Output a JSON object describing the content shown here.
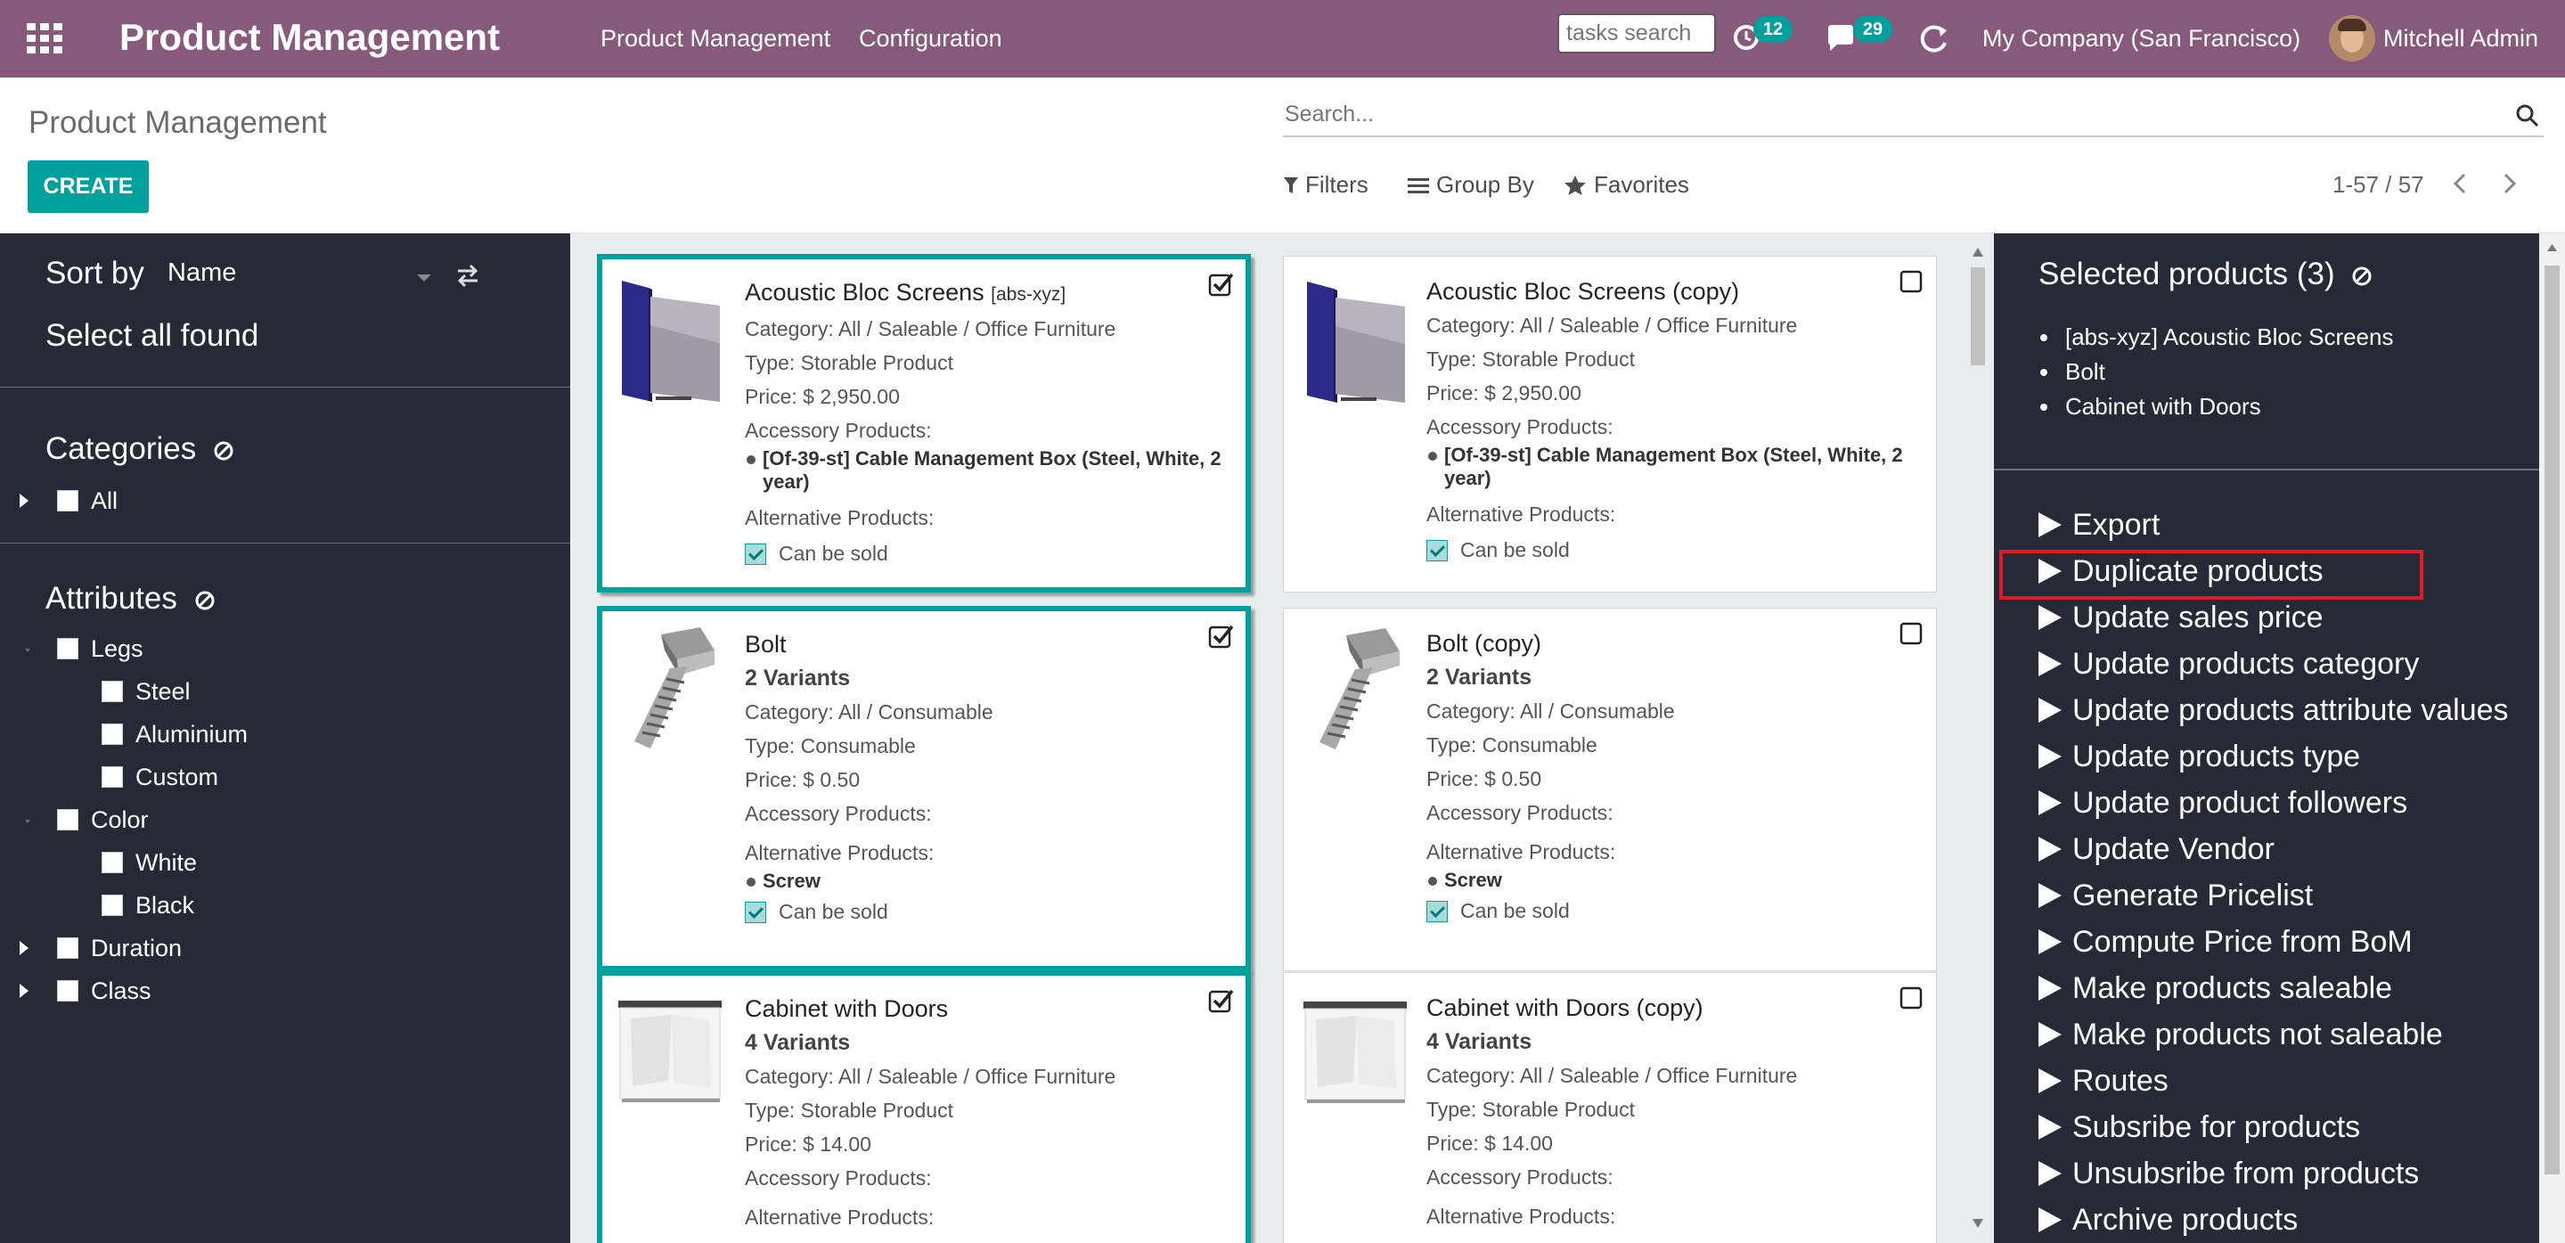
{
  "navbar": {
    "brand": "Product Management",
    "menu": [
      "Product Management",
      "Configuration"
    ],
    "task_search_placeholder": "tasks search",
    "activity_count": "12",
    "messages_count": "29",
    "company": "My Company (San Francisco)",
    "user": "Mitchell Admin",
    "bg_color": "#875a7b"
  },
  "control_panel": {
    "title": "Product Management",
    "create_label": "CREATE",
    "search_placeholder": "Search...",
    "filters_label": "Filters",
    "group_by_label": "Group By",
    "favorites_label": "Favorites",
    "pager": "1-57 / 57"
  },
  "left_panel": {
    "sort_label": "Sort by",
    "sort_value": "Name",
    "select_all_label": "Select all found",
    "categories_title": "Categories",
    "categories": [
      {
        "label": "All",
        "expandable": true
      }
    ],
    "attributes_title": "Attributes",
    "attributes": [
      {
        "label": "Legs",
        "children": [
          "Steel",
          "Aluminium",
          "Custom"
        ]
      },
      {
        "label": "Color",
        "children": [
          "White",
          "Black"
        ]
      },
      {
        "label": "Duration",
        "children": []
      },
      {
        "label": "Class",
        "children": []
      }
    ]
  },
  "cards": [
    {
      "title": "Acoustic Bloc Screens",
      "code": "[abs-xyz]",
      "variants": "",
      "category": "Category: All / Saleable / Office Furniture",
      "type": "Type: Storable Product",
      "price": "Price: $ 2,950.00",
      "accessory_label": "Accessory Products:",
      "accessories": [
        "[Of-39-st] Cable Management Box (Steel, White, 2 year)"
      ],
      "alternative_label": "Alternative Products:",
      "alternatives": [],
      "sold_label": "Can be sold",
      "selected": true,
      "image": "screen"
    },
    {
      "title": "Acoustic Bloc Screens (copy)",
      "code": "",
      "variants": "",
      "category": "Category: All / Saleable / Office Furniture",
      "type": "Type: Storable Product",
      "price": "Price: $ 2,950.00",
      "accessory_label": "Accessory Products:",
      "accessories": [
        "[Of-39-st] Cable Management Box (Steel, White, 2 year)"
      ],
      "alternative_label": "Alternative Products:",
      "alternatives": [],
      "sold_label": "Can be sold",
      "selected": false,
      "image": "screen"
    },
    {
      "title": "Bolt",
      "code": "",
      "variants": "2 Variants",
      "category": "Category: All / Consumable",
      "type": "Type: Consumable",
      "price": "Price: $ 0.50",
      "accessory_label": "Accessory Products:",
      "accessories": [],
      "alternative_label": "Alternative Products:",
      "alternatives": [
        "Screw"
      ],
      "sold_label": "Can be sold",
      "selected": true,
      "image": "bolt"
    },
    {
      "title": "Bolt (copy)",
      "code": "",
      "variants": "2 Variants",
      "category": "Category: All / Consumable",
      "type": "Type: Consumable",
      "price": "Price: $ 0.50",
      "accessory_label": "Accessory Products:",
      "accessories": [],
      "alternative_label": "Alternative Products:",
      "alternatives": [
        "Screw"
      ],
      "sold_label": "Can be sold",
      "selected": false,
      "image": "bolt"
    },
    {
      "title": "Cabinet with Doors",
      "code": "",
      "variants": "4 Variants",
      "category": "Category: All / Saleable / Office Furniture",
      "type": "Type: Storable Product",
      "price": "Price: $ 14.00",
      "accessory_label": "Accessory Products:",
      "accessories": [],
      "alternative_label": "Alternative Products:",
      "alternatives": [],
      "sold_label": "",
      "selected": true,
      "image": "cabinet"
    },
    {
      "title": "Cabinet with Doors (copy)",
      "code": "",
      "variants": "4 Variants",
      "category": "Category: All / Saleable / Office Furniture",
      "type": "Type: Storable Product",
      "price": "Price: $ 14.00",
      "accessory_label": "Accessory Products:",
      "accessories": [],
      "alternative_label": "Alternative Products:",
      "alternatives": [],
      "sold_label": "",
      "selected": false,
      "image": "cabinet"
    }
  ],
  "right_panel": {
    "selected_title": "Selected products (3)",
    "selected_items": [
      "[abs-xyz] Acoustic Bloc Screens",
      "Bolt",
      "Cabinet with Doors"
    ],
    "actions": [
      "Export",
      "Duplicate products",
      "Update sales price",
      "Update products category",
      "Update products attribute values",
      "Update products type",
      "Update product followers",
      "Update Vendor",
      "Generate Pricelist",
      "Compute Price from BoM",
      "Make products saleable",
      "Make products not saleable",
      "Routes",
      "Subsribe for products",
      "Unsubsribe from products",
      "Archive products"
    ],
    "highlighted_action": "Duplicate products"
  },
  "colors": {
    "accent": "#00a09d",
    "sidebar_bg": "#262a36",
    "highlight": "#e01b24"
  }
}
